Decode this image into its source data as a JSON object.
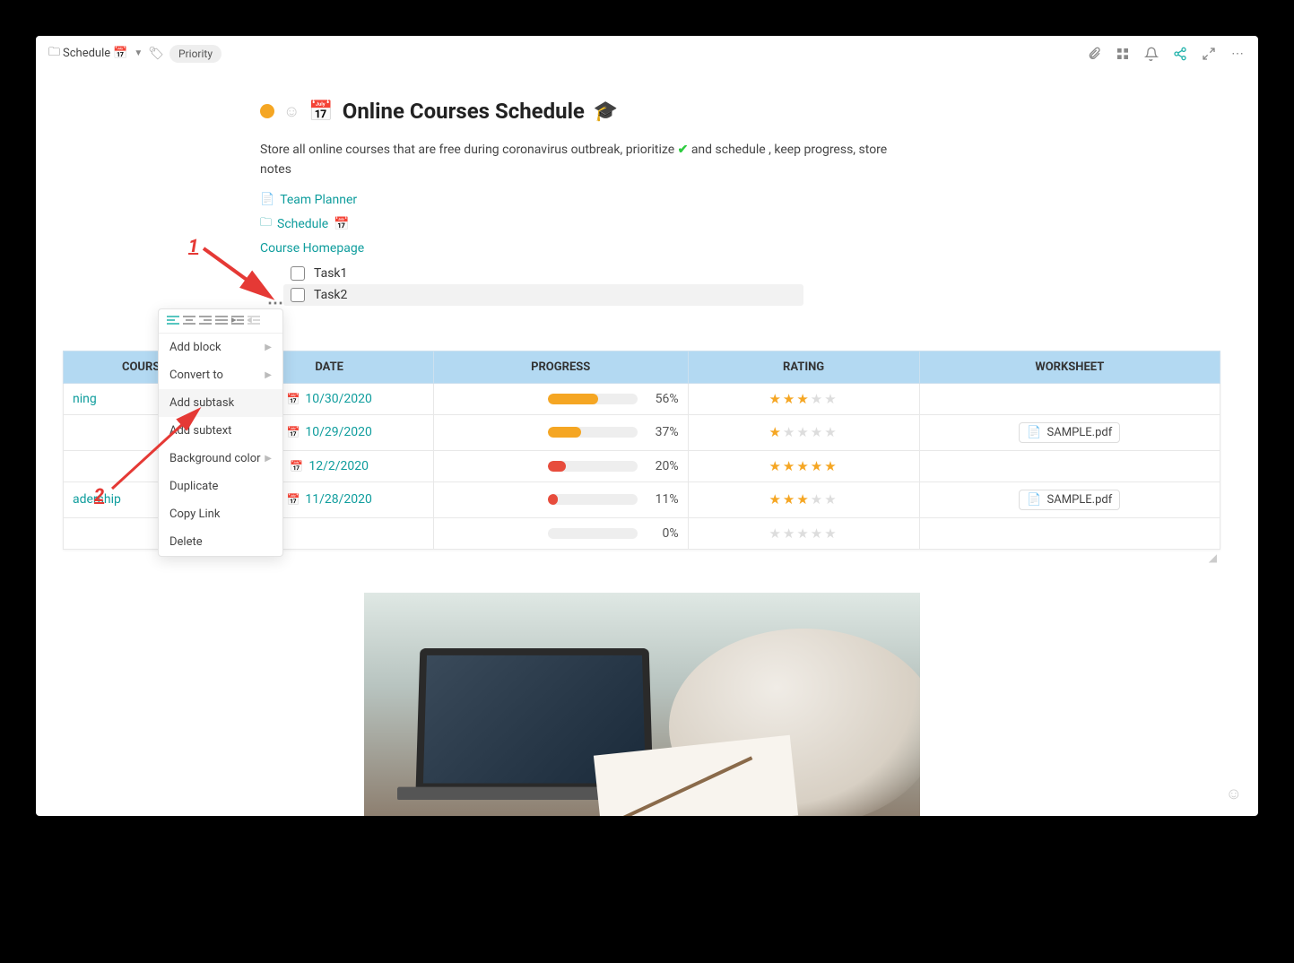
{
  "breadcrumb": {
    "label": "Schedule",
    "emoji": "📅"
  },
  "tag_pill": "Priority",
  "page": {
    "title": "Online Courses Schedule",
    "emoji_cal": "📅",
    "emoji_grad": "🎓",
    "desc_before": "Store all online courses that are free during coronavirus outbreak, prioritize ",
    "desc_after": " and schedule , keep progress, store notes"
  },
  "links": {
    "team_planner": "Team Planner",
    "schedule": "Schedule",
    "schedule_emoji": "📅",
    "homepage": "Course Homepage"
  },
  "tasks": [
    "Task1",
    "Task2"
  ],
  "ctx": {
    "add_block": "Add block",
    "convert": "Convert to",
    "add_subtask": "Add subtask",
    "add_subtext": "Add subtext",
    "bg_color": "Background color",
    "duplicate": "Duplicate",
    "copy_link": "Copy Link",
    "delete": "Delete"
  },
  "anno": {
    "one": "1",
    "two": "2"
  },
  "table": {
    "headers": [
      "COURSE",
      "DATE",
      "PROGRESS",
      "RATING",
      "WORKSHEET"
    ],
    "rows": [
      {
        "course": "ning",
        "date": "10/30/2020",
        "pct": 56,
        "color": "orange",
        "stars": 3,
        "file": ""
      },
      {
        "course": "",
        "date": "10/29/2020",
        "pct": 37,
        "color": "orange",
        "stars": 1,
        "file": "SAMPLE.pdf"
      },
      {
        "course": "",
        "date": "12/2/2020",
        "pct": 20,
        "color": "red",
        "stars": 5,
        "file": ""
      },
      {
        "course": "adership",
        "date": "11/28/2020",
        "pct": 11,
        "color": "red",
        "stars": 3,
        "file": "SAMPLE.pdf"
      },
      {
        "course": "",
        "date": "",
        "pct": 0,
        "color": "none",
        "stars": 0,
        "file": ""
      }
    ]
  }
}
